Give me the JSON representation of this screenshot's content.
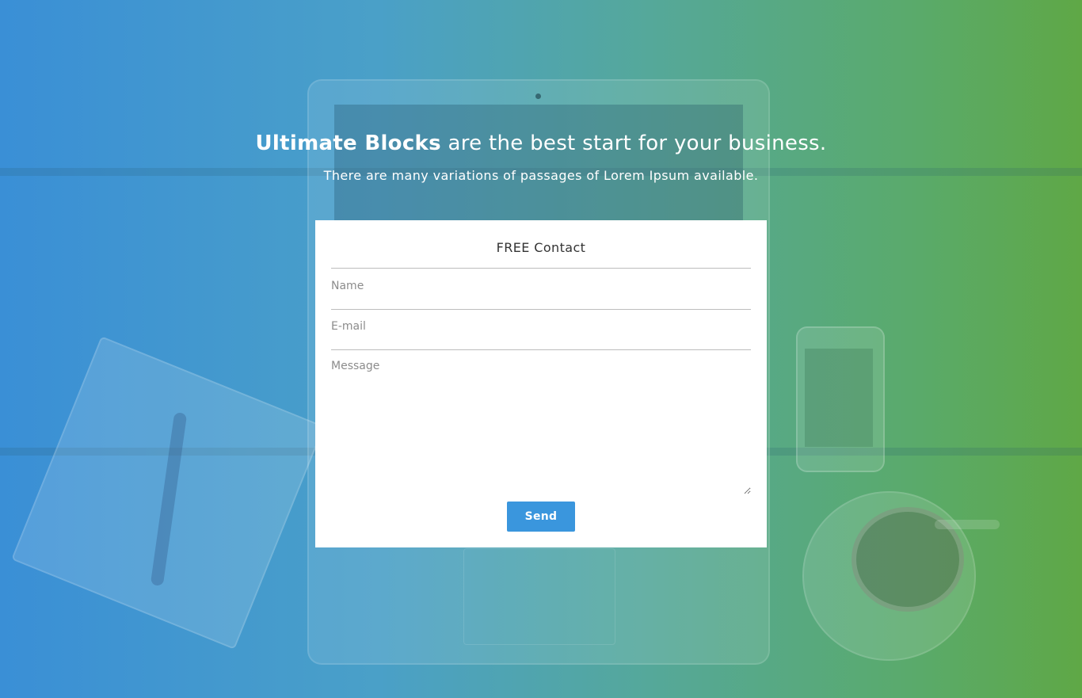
{
  "hero": {
    "headline_bold": "Ultimate Blocks",
    "headline_rest": " are the best start for your business.",
    "subline": "There are many variations of passages of Lorem Ipsum available."
  },
  "form": {
    "title": "FREE Contact",
    "name_placeholder": "Name",
    "email_placeholder": "E-mail",
    "message_placeholder": "Message",
    "send_label": "Send"
  },
  "colors": {
    "gradient_start": "#3a8fd6",
    "gradient_end": "#5fa846",
    "button": "#3a96dd"
  }
}
